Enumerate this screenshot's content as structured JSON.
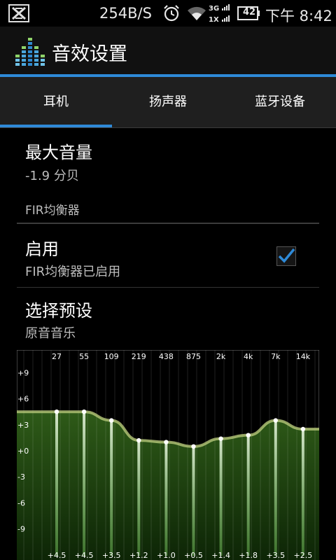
{
  "status_bar": {
    "network_speed": "254B/S",
    "network_type_top": "3G",
    "network_type_bottom": "1X",
    "battery_level": "42",
    "time": "下午 8:42"
  },
  "action_bar": {
    "title": "音效设置"
  },
  "tabs": [
    {
      "label": "耳机",
      "active": true
    },
    {
      "label": "扬声器",
      "active": false
    },
    {
      "label": "蓝牙设备",
      "active": false
    }
  ],
  "max_volume": {
    "title": "最大音量",
    "value": "-1.9 分贝"
  },
  "fir_section": {
    "label": "FIR均衡器"
  },
  "enable": {
    "title": "启用",
    "summary": "FIR均衡器已启用",
    "checked": true
  },
  "preset": {
    "title": "选择预设",
    "value": "原音音乐"
  },
  "equalizer": {
    "frequencies": [
      "27",
      "55",
      "109",
      "219",
      "438",
      "875",
      "2k",
      "4k",
      "7k",
      "14k"
    ],
    "gains": [
      4.5,
      4.5,
      3.5,
      1.2,
      1.0,
      0.5,
      1.4,
      1.8,
      3.5,
      2.5
    ],
    "gain_labels": [
      "+4.5",
      "+4.5",
      "+3.5",
      "+1.2",
      "+1.0",
      "+0.5",
      "+1.4",
      "+1.8",
      "+3.5",
      "+2.5"
    ],
    "db_scale": [
      "+9",
      "+6",
      "+3",
      "+0",
      "-3",
      "-6",
      "-9"
    ],
    "db_values": [
      9,
      6,
      3,
      0,
      -3,
      -6,
      -9
    ]
  },
  "colors": {
    "accent": "#2e8ad8",
    "eq_curve": "#b8c97a",
    "eq_fill_top": "#2e5a18",
    "eq_fill_bottom": "#0f2a08"
  }
}
